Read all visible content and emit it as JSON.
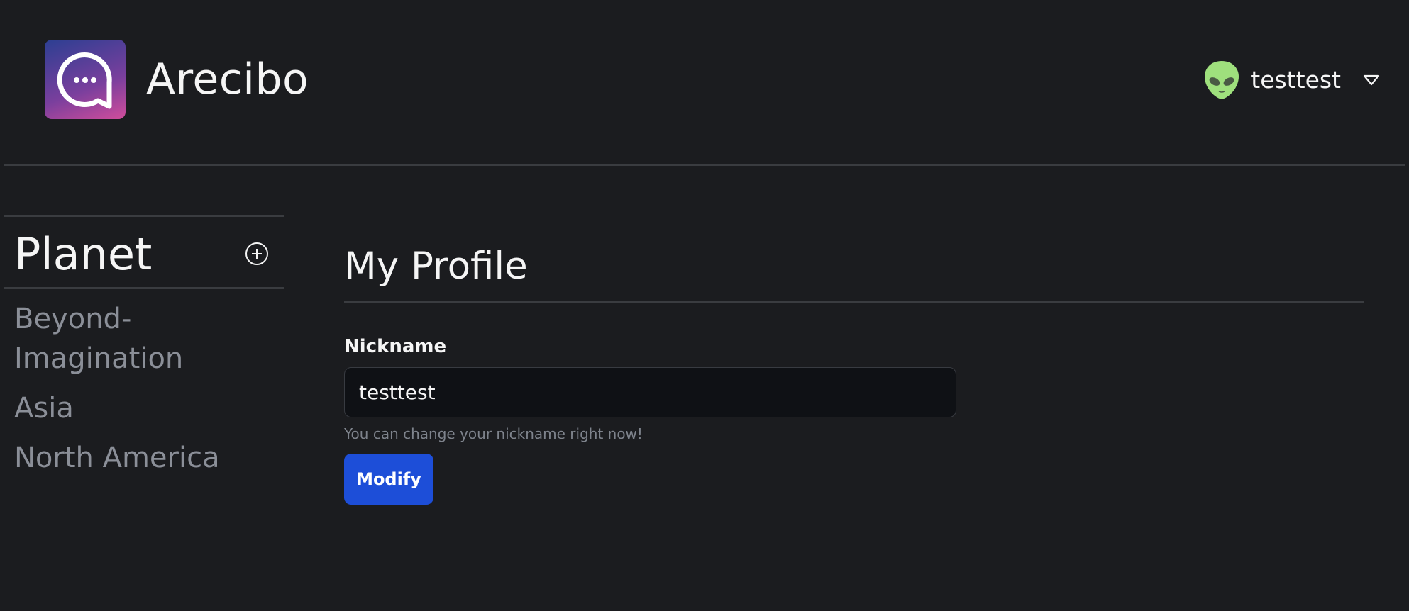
{
  "app": {
    "title": "Arecibo"
  },
  "user": {
    "name": "testtest"
  },
  "sidebar": {
    "title": "Planet",
    "items": [
      {
        "label": "Beyond-\nImagination"
      },
      {
        "label": "Asia"
      },
      {
        "label": "North America"
      }
    ]
  },
  "profile": {
    "title": "My Profile",
    "nickname_label": "Nickname",
    "nickname_value": "testtest",
    "helper": "You can change your nickname right now!",
    "submit_label": "Modify"
  },
  "icons": {
    "logo": "chat-bubble-logo-icon",
    "avatar": "alien-avatar-icon",
    "dropdown": "chevron-down-icon",
    "add": "plus-circle-icon"
  },
  "colors": {
    "background": "#1b1c1f",
    "accent": "#1d4ed8",
    "muted_text": "#8b8f98",
    "input_bg": "#0f1115",
    "logo_gradient": [
      "#2c3f92",
      "#7a3f9d",
      "#d14d9b"
    ],
    "avatar": "#9fe07d"
  }
}
